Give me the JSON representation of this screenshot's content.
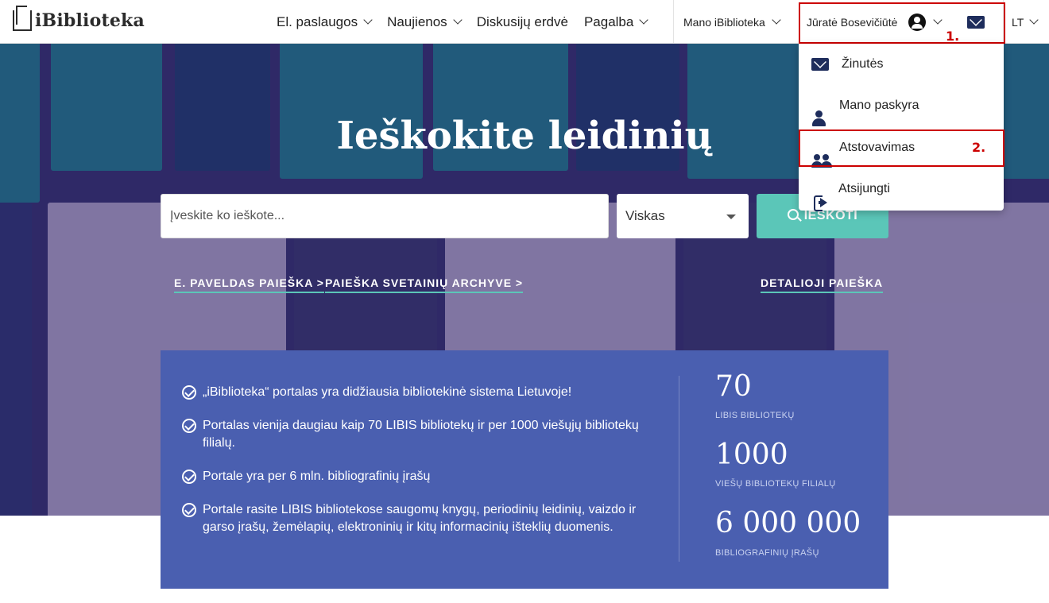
{
  "brand": {
    "logo_text": "iBiblioteka"
  },
  "nav": {
    "items": [
      {
        "label": "El. paslaugos",
        "has_chevron": true
      },
      {
        "label": "Naujienos",
        "has_chevron": true
      },
      {
        "label": "Diskusijų erdvė",
        "has_chevron": false
      },
      {
        "label": "Pagalba",
        "has_chevron": true
      }
    ],
    "my_library": "Mano iBiblioteka",
    "user_name": "Jūratė Bosevičiūtė",
    "language": "LT",
    "step1_label": "1."
  },
  "user_menu": {
    "items": [
      {
        "label": "Žinutės",
        "icon": "envelope-icon"
      },
      {
        "label": "Mano paskyra",
        "icon": "person-icon"
      },
      {
        "label": "Atstovavimas",
        "icon": "people-icon"
      },
      {
        "label": "Atsijungti",
        "icon": "logout-icon"
      }
    ],
    "step2_label": "2."
  },
  "hero": {
    "title": "Ieškokite leidinių",
    "search_placeholder": "Įveskite ko ieškote...",
    "select_value": "Viskas",
    "search_button": "IEŠKOTI",
    "links": {
      "epaveldas": "E. PAVELDAS PAIEŠKA >",
      "archive": "PAIEŠKA SVETAINIŲ ARCHYVE >",
      "detailed": "DETALIOJI PAIEŠKA"
    }
  },
  "info": {
    "bullets": [
      "„iBiblioteka“ portalas yra didžiausia bibliotekinė sistema Lietuvoje!",
      "Portalas vienija daugiau kaip 70 LIBIS bibliotekų ir per 1000 viešųjų bibliotekų filialų.",
      "Portale yra per 6 mln. bibliografinių įrašų",
      "Portale rasite LIBIS bibliotekose saugomų knygų, periodinių leidinių, vaizdo ir garso įrašų, žemėlapių, elektroninių ir kitų informacinių išteklių duomenis."
    ],
    "stats": [
      {
        "value": "70",
        "label": "LIBIS BIBLIOTEKŲ"
      },
      {
        "value": "1000",
        "label": "VIEŠŲ BIBLIOTEKŲ FILIALŲ"
      },
      {
        "value": "6 000 000",
        "label": "BIBLIOGRAFINIŲ ĮRAŠŲ"
      }
    ]
  },
  "colors": {
    "accent_teal": "#5bc6b8",
    "info_bg": "#4a5fb0",
    "highlight_red": "#cc0000",
    "icon_navy": "#1e2d5c"
  }
}
